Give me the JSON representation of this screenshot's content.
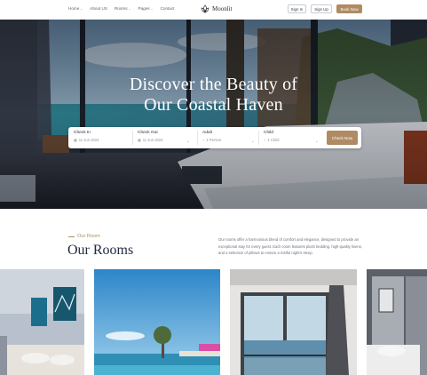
{
  "nav": {
    "links": [
      {
        "label": "Home",
        "has_caret": true
      },
      {
        "label": "About US",
        "has_caret": false
      },
      {
        "label": "Rooms",
        "has_caret": true
      },
      {
        "label": "Pages",
        "has_caret": true
      },
      {
        "label": "Contact",
        "has_caret": false
      }
    ],
    "logo_text": "Moonlit",
    "sign_in": "Sign In",
    "sign_up": "Sign Up",
    "book_now": "Book Now"
  },
  "hero": {
    "title_line1": "Discover the Beauty of",
    "title_line2": "Our Coastal Haven"
  },
  "booking": {
    "check_in_label": "Check In",
    "check_in_value": "11 Jun 2024",
    "check_out_label": "Check Out",
    "check_out_value": "11 Jun 2024",
    "adult_label": "Adult",
    "adult_value": "1 Person",
    "child_label": "Child",
    "child_value": "1 Child",
    "submit_label": "Check Now"
  },
  "rooms": {
    "eyebrow": "Our Room",
    "title": "Our Rooms",
    "description": "Our rooms offer a harmonious blend of comfort and elegance, designed to provide an exceptional stay for every guest. Each room features plush bedding, high-quality linens, and a selection of pillows to ensure a restful night's sleep."
  },
  "colors": {
    "accent": "#b08a63",
    "heading": "#1d2a3f"
  },
  "icons": {
    "calendar": "calendar-icon",
    "person": "person-icon",
    "caret": "chevron-down-icon"
  }
}
